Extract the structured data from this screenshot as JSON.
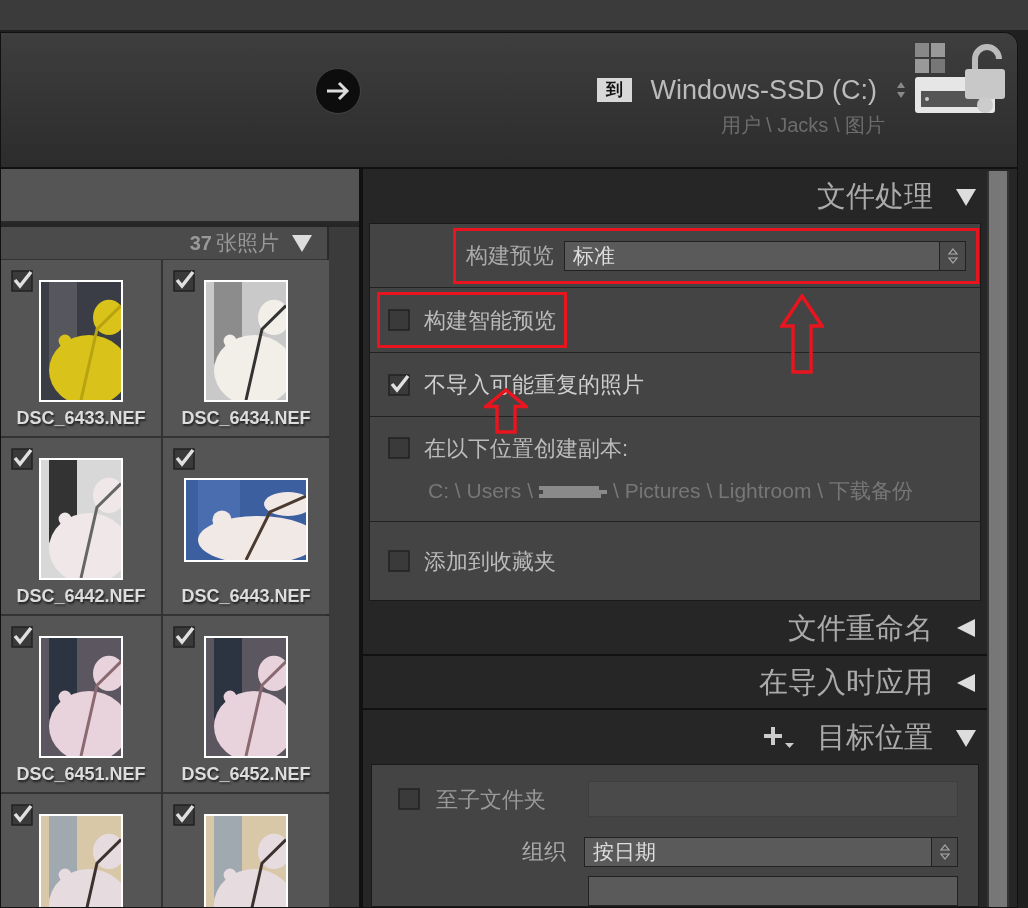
{
  "destination": {
    "label": "到",
    "drive": "Windows-SSD (C:)",
    "path": "用户 \\ Jacks \\ 图片"
  },
  "grid": {
    "count_number": "37",
    "count_label": "张照片",
    "expanded": true,
    "thumbnails": [
      {
        "filename": "DSC_6433.NEF",
        "checked": true
      },
      {
        "filename": "DSC_6434.NEF",
        "checked": true
      },
      {
        "filename": "DSC_6442.NEF",
        "checked": true
      },
      {
        "filename": "DSC_6443.NEF",
        "checked": true
      },
      {
        "filename": "DSC_6451.NEF",
        "checked": true
      },
      {
        "filename": "DSC_6452.NEF",
        "checked": true
      },
      {
        "checked": true
      },
      {
        "checked": true
      }
    ]
  },
  "file_handling": {
    "title": "文件处理",
    "expanded": true,
    "build_previews": {
      "label": "构建预览",
      "value": "标准",
      "highlighted": true
    },
    "options": [
      {
        "label": "构建智能预览",
        "checked": false,
        "highlighted": true
      },
      {
        "label": "不导入可能重复的照片",
        "checked": true
      },
      {
        "label": "在以下位置创建副本:",
        "checked": false,
        "path_before": "C: \\ Users \\",
        "path_after": "\\ Pictures \\ Lightroom \\ 下载备份"
      },
      {
        "label": "添加到收藏夹",
        "checked": false
      }
    ]
  },
  "collapsed_sections": [
    {
      "title": "文件重命名",
      "expanded": false
    },
    {
      "title": "在导入时应用",
      "expanded": false
    }
  ],
  "destination_panel": {
    "title": "目标位置",
    "expanded": true,
    "subfolder": {
      "label": "至子文件夹",
      "checked": false
    },
    "organize": {
      "label": "组织",
      "value": "按日期"
    }
  },
  "annotations": [
    {
      "kind": "arrow"
    },
    {
      "kind": "arrow"
    }
  ]
}
